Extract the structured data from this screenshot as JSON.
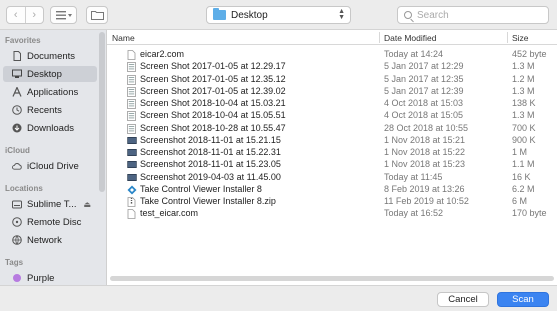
{
  "toolbar": {
    "back": "‹",
    "forward": "›",
    "location": "Desktop",
    "search_placeholder": "Search"
  },
  "sidebar": {
    "favorites_heading": "Favorites",
    "favorites": [
      {
        "label": "Documents",
        "icon": "documents-icon"
      },
      {
        "label": "Desktop",
        "icon": "desktop-icon",
        "selected": true
      },
      {
        "label": "Applications",
        "icon": "applications-icon"
      },
      {
        "label": "Recents",
        "icon": "recents-icon"
      },
      {
        "label": "Downloads",
        "icon": "downloads-icon"
      }
    ],
    "icloud_heading": "iCloud",
    "icloud": [
      {
        "label": "iCloud Drive",
        "icon": "cloud-icon"
      }
    ],
    "locations_heading": "Locations",
    "locations": [
      {
        "label": "Sublime T...",
        "icon": "disk-icon",
        "eject": "⏏"
      },
      {
        "label": "Remote Disc",
        "icon": "disc-icon"
      },
      {
        "label": "Network",
        "icon": "network-icon"
      }
    ],
    "tags_heading": "Tags",
    "tags": [
      {
        "label": "Purple",
        "color": "#b77be0"
      }
    ]
  },
  "columns": {
    "name": "Name",
    "date": "Date Modified",
    "size": "Size"
  },
  "files": [
    {
      "name": "eicar2.com",
      "date": "Today at 14:24",
      "size": "452 byte",
      "icon": "document-icon"
    },
    {
      "name": "Screen Shot 2017-01-05 at 12.29.17",
      "date": "5 Jan 2017 at 12:29",
      "size": "1.3 M",
      "icon": "image-icon"
    },
    {
      "name": "Screen Shot 2017-01-05 at 12.35.12",
      "date": "5 Jan 2017 at 12:35",
      "size": "1.2 M",
      "icon": "image-icon"
    },
    {
      "name": "Screen Shot 2017-01-05 at 12.39.02",
      "date": "5 Jan 2017 at 12:39",
      "size": "1.3 M",
      "icon": "image-icon"
    },
    {
      "name": "Screen Shot 2018-10-04 at 15.03.21",
      "date": "4 Oct 2018 at 15:03",
      "size": "138 K",
      "icon": "image-icon"
    },
    {
      "name": "Screen Shot 2018-10-04 at 15.05.51",
      "date": "4 Oct 2018 at 15:05",
      "size": "1.3 M",
      "icon": "image-icon"
    },
    {
      "name": "Screen Shot 2018-10-28 at 10.55.47",
      "date": "28 Oct 2018 at 10:55",
      "size": "700 K",
      "icon": "image-icon"
    },
    {
      "name": "Screenshot 2018-11-01 at 15.21.15",
      "date": "1 Nov 2018 at 15:21",
      "size": "900 K",
      "icon": "screenshot-icon"
    },
    {
      "name": "Screenshot 2018-11-01 at 15.22.31",
      "date": "1 Nov 2018 at 15:22",
      "size": "1 M",
      "icon": "screenshot-icon"
    },
    {
      "name": "Screenshot 2018-11-01 at 15.23.05",
      "date": "1 Nov 2018 at 15:23",
      "size": "1.1 M",
      "icon": "screenshot-icon"
    },
    {
      "name": "Screenshot 2019-04-03 at 11.45.00",
      "date": "Today at 11:45",
      "size": "16 K",
      "icon": "screenshot-icon"
    },
    {
      "name": "Take Control Viewer Installer 8",
      "date": "8 Feb 2019 at 13:26",
      "size": "6.2 M",
      "icon": "installer-icon"
    },
    {
      "name": "Take Control Viewer Installer 8.zip",
      "date": "11 Feb 2019 at 10:52",
      "size": "6 M",
      "icon": "zip-icon"
    },
    {
      "name": "test_eicar.com",
      "date": "Today at 16:52",
      "size": "170 byte",
      "icon": "document-icon"
    }
  ],
  "buttons": {
    "cancel": "Cancel",
    "scan": "Scan"
  }
}
